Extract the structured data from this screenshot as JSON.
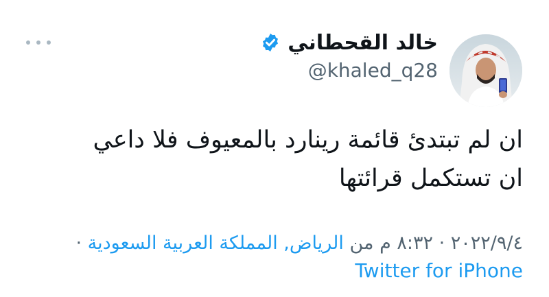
{
  "tweet": {
    "author": {
      "display_name": "خالد القحطاني",
      "handle": "@khaled_q28",
      "verified": true
    },
    "text_lines": [
      "ان لم تبتدئ قائمة رينارد بالمعيوف فلا داعي",
      "ان تستكمل قرائتها"
    ],
    "meta": {
      "date": "٢٠٢٢/٩/٤",
      "separator": "·",
      "time": "٨:٣٢ م",
      "from_word": "من",
      "location": "الرياض, المملكة العربية السعودية",
      "source": "Twitter for iPhone"
    }
  },
  "icons": {
    "verified": "verified-badge-icon",
    "more": "more-options-icon"
  },
  "colors": {
    "accent": "#1d9bf0",
    "text_primary": "#0f1419",
    "text_secondary": "#536471",
    "dots": "#aab8c2"
  }
}
